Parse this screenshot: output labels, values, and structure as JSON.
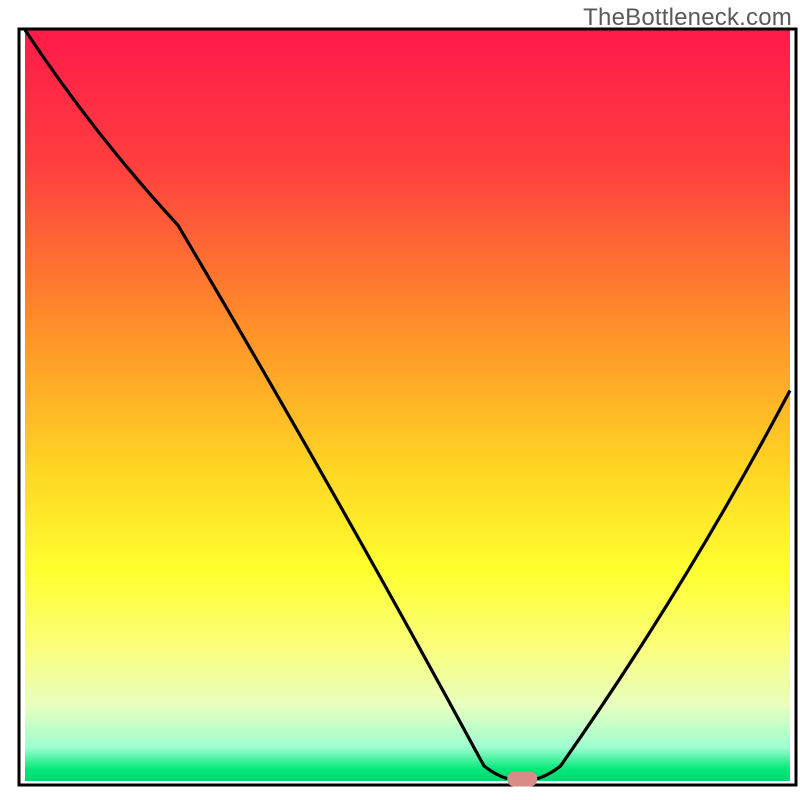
{
  "watermark": "TheBottleneck.com",
  "chart_data": {
    "type": "line",
    "title": "",
    "xlabel": "",
    "ylabel": "",
    "xlim": [
      0,
      100
    ],
    "ylim": [
      0,
      100
    ],
    "x": [
      0,
      20,
      60,
      65,
      70,
      100
    ],
    "values": [
      100,
      74,
      2,
      0,
      2,
      52
    ],
    "minimum_marker": {
      "x": 65,
      "y": 0
    },
    "gradient_stops": [
      {
        "offset": 0.0,
        "color": "#ff1a4a"
      },
      {
        "offset": 0.18,
        "color": "#ff3f3f"
      },
      {
        "offset": 0.38,
        "color": "#ff8a2a"
      },
      {
        "offset": 0.58,
        "color": "#ffd423"
      },
      {
        "offset": 0.72,
        "color": "#ffff2f"
      },
      {
        "offset": 0.82,
        "color": "#faff7a"
      },
      {
        "offset": 0.9,
        "color": "#e8ffc0"
      },
      {
        "offset": 0.955,
        "color": "#9effd0"
      },
      {
        "offset": 0.985,
        "color": "#00e878"
      },
      {
        "offset": 1.0,
        "color": "#00d770"
      }
    ],
    "description": "Bottleneck percentage curve. Background gradient runs red (high bottleneck) at top through orange and yellow to green (optimal) at bottom. Black curve descends from top-left, changes inflection around x≈20, reaches minimum near x≈65 (marked with a small salmon pill), then rises toward the right edge to about mid-height."
  }
}
